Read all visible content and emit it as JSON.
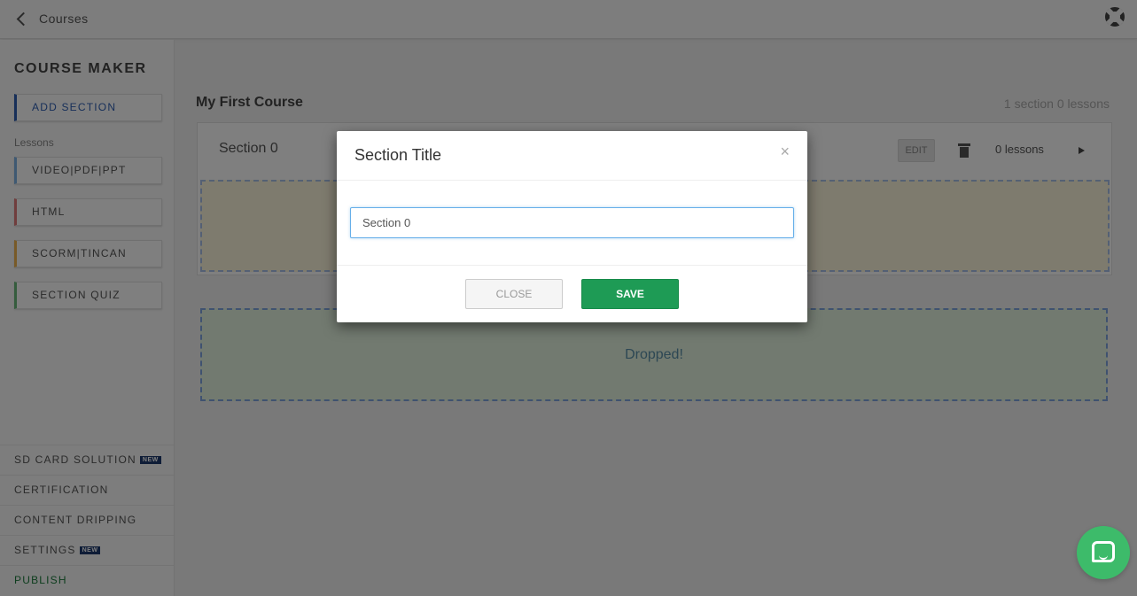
{
  "topbar": {
    "breadcrumb": "Courses"
  },
  "sidebar": {
    "title": "COURSE MAKER",
    "add_section": "ADD SECTION",
    "lessons_label": "Lessons",
    "lesson_types": [
      {
        "label": "VIDEO|PDF|PPT",
        "color": "#7fb3e5"
      },
      {
        "label": "HTML",
        "color": "#e07a7a"
      },
      {
        "label": "SCORM|TINCAN",
        "color": "#f0b450"
      },
      {
        "label": "SECTION QUIZ",
        "color": "#6ab87a"
      }
    ],
    "footer": [
      {
        "label": "SD CARD SOLUTION",
        "badge": "NEW"
      },
      {
        "label": "CERTIFICATION",
        "badge": ""
      },
      {
        "label": "CONTENT DRIPPING",
        "badge": ""
      },
      {
        "label": "SETTINGS",
        "badge": "NEW"
      },
      {
        "label": "PUBLISH",
        "badge": ""
      }
    ]
  },
  "course": {
    "title": "My First Course",
    "meta": "1 section 0 lessons",
    "section": {
      "name": "Section 0",
      "edit_label": "EDIT",
      "lesson_count": "0 lessons"
    },
    "drop_text": "Dropped!"
  },
  "modal": {
    "title": "Section Title",
    "close_x": "×",
    "input_value": "Section 0",
    "close_label": "CLOSE",
    "save_label": "SAVE"
  },
  "colors": {
    "accent_blue": "#2f5fb3",
    "save_green": "#1e9b55",
    "chat_green": "#3dbb6a",
    "badge_navy": "#1e3a6e"
  },
  "icons": {
    "back": "chevron-left-icon",
    "help": "lifebuoy-icon",
    "delete": "trash-icon",
    "expand": "play-icon",
    "chat": "chat-icon"
  }
}
